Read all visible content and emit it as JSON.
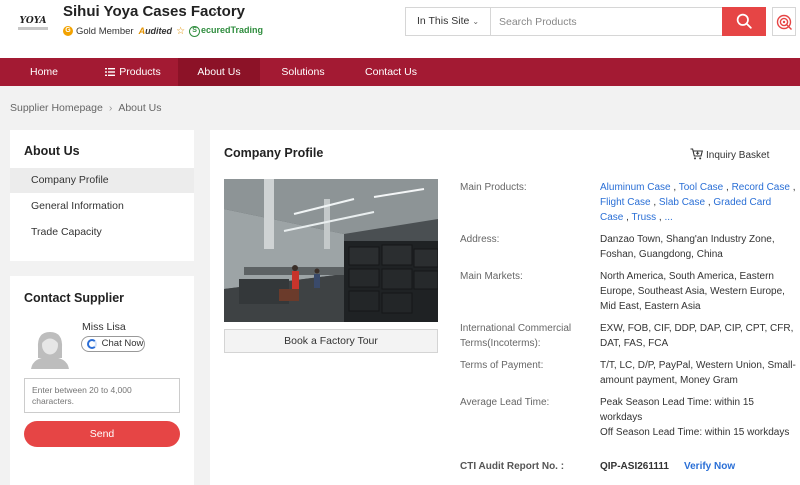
{
  "header": {
    "logo_text": "YOYA",
    "company_name": "Sihui Yoya Cases Factory",
    "gold_member": "Gold Member",
    "audited_prefix": "A",
    "audited_rest": "udited",
    "secured_prefix": "S",
    "secured_rest": "ecuredTrading",
    "search_scope": "In This Site",
    "search_placeholder": "Search Products"
  },
  "nav": {
    "items": [
      "Home",
      "Products",
      "About Us",
      "Solutions",
      "Contact Us"
    ],
    "active": "About Us"
  },
  "breadcrumb": [
    "Supplier Homepage",
    "About Us"
  ],
  "about_panel": {
    "title": "About Us",
    "items": [
      "Company Profile",
      "General Information",
      "Trade Capacity"
    ],
    "active": "Company Profile"
  },
  "contact_panel": {
    "title": "Contact Supplier",
    "contact_name": "Miss Lisa",
    "chat_label": "Chat Now",
    "message_placeholder": "Enter between 20 to 4,000 characters.",
    "send_label": "Send"
  },
  "main": {
    "title": "Company Profile",
    "inquiry_label": "Inquiry Basket",
    "tour_label": "Book a Factory Tour",
    "main_products_label": "Main Products:",
    "main_products": [
      "Aluminum Case",
      "Tool Case",
      "Record Case",
      "Flight Case",
      "Slab Case",
      "Graded Card Case",
      "Truss",
      "..."
    ],
    "address_label": "Address:",
    "address_value": "Danzao Town, Shang'an Industry Zone, Foshan, Guangdong, China",
    "markets_label": "Main Markets:",
    "markets_value": "North America, South America, Eastern Europe, Southeast Asia, Western Europe, Mid East, Eastern Asia",
    "incoterms_label": "International Commercial Terms(Incoterms):",
    "incoterms_value": "EXW, FOB, CIF, DDP, DAP, CIP, CPT, CFR, DAT, FAS, FCA",
    "payment_label": "Terms of Payment:",
    "payment_value": "T/T, LC, D/P, PayPal, Western Union, Small-amount payment, Money Gram",
    "lead_label": "Average Lead Time:",
    "lead_peak": "Peak Season Lead Time: within 15 workdays",
    "lead_off": "Off Season Lead Time: within 15 workdays",
    "cti_label": "CTI Audit Report No. :",
    "cti_value": "QIP-ASI261111",
    "verify_label": "Verify Now"
  },
  "colors": {
    "nav_bg": "#a31a33",
    "nav_active": "#8c1227",
    "accent_red": "#e64545",
    "link_blue": "#2a6fd6"
  }
}
